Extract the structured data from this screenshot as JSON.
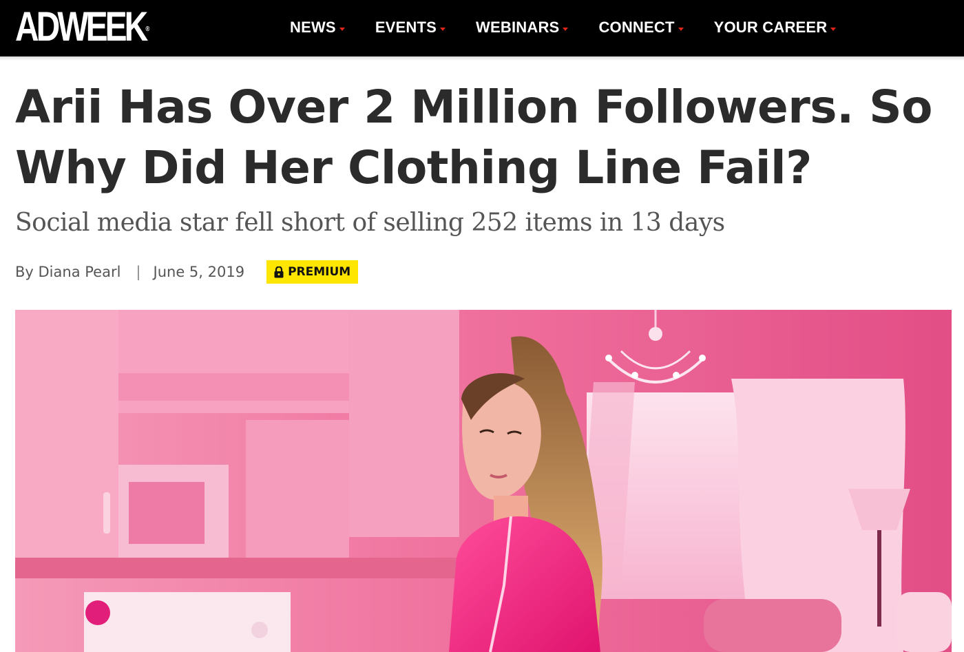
{
  "brand": {
    "logo_text": "ADWEEK",
    "logo_mark": "®"
  },
  "nav": {
    "items": [
      {
        "label": "NEWS"
      },
      {
        "label": "EVENTS"
      },
      {
        "label": "WEBINARS"
      },
      {
        "label": "CONNECT"
      },
      {
        "label": "YOUR CAREER"
      }
    ],
    "caret_color": "#e0261b"
  },
  "article": {
    "headline": "Arii Has Over 2 Million Followers. So Why Did Her Clothing Line Fail?",
    "subhead": "Social media star fell short of selling 252 items in 13 days",
    "byline": "By Diana Pearl",
    "separator": "|",
    "date": "June 5, 2019",
    "badge": {
      "label": "PREMIUM",
      "icon": "lock-icon",
      "color": "#ffe600"
    }
  },
  "hero_image": {
    "description_icon": "photo"
  },
  "colors": {
    "header_bg": "#000000",
    "accent": "#e0261b",
    "text": "#2b2b2b"
  }
}
